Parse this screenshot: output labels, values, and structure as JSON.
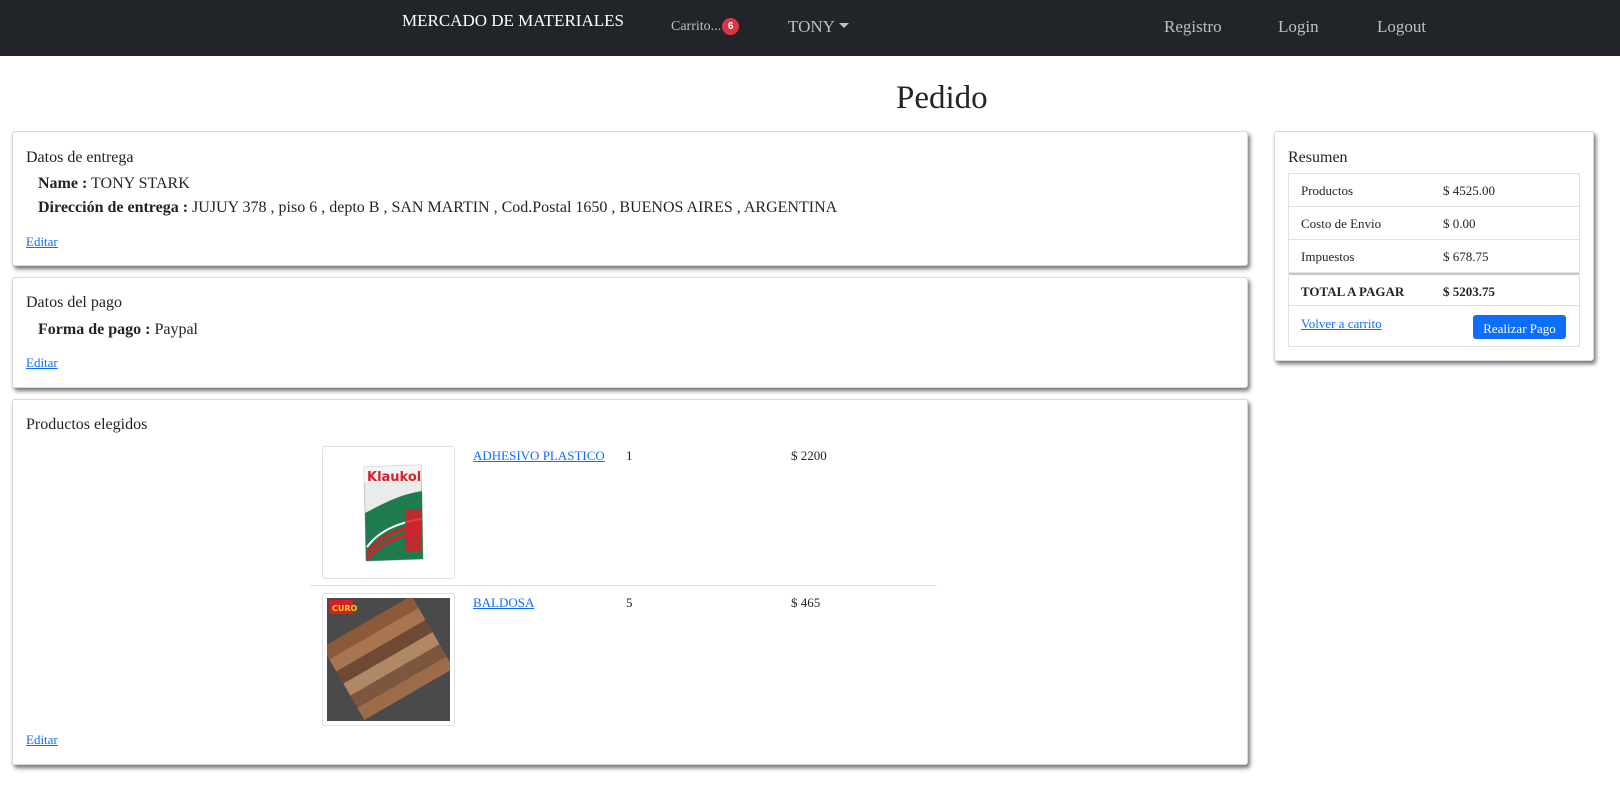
{
  "navbar": {
    "brand": "MERCADO DE MATERIALES",
    "cart_label": "Carrito...",
    "cart_count": "6",
    "user_label": "TONY",
    "links": {
      "registro": "Registro",
      "login": "Login",
      "logout": "Logout"
    }
  },
  "page": {
    "title": "Pedido"
  },
  "delivery": {
    "title": "Datos de entrega",
    "name_label": "Name :",
    "name_value": "TONY STARK",
    "address_label": "Dirección de entrega :",
    "address_value": "JUJUY 378 , piso 6 , depto B , SAN MARTIN , Cod.Postal 1650 , BUENOS AIRES , ARGENTINA",
    "edit_label": "Editar"
  },
  "payment": {
    "title": "Datos del pago",
    "method_label": "Forma de pago :",
    "method_value": "Paypal",
    "edit_label": "Editar"
  },
  "products": {
    "title": "Productos elegidos",
    "edit_label": "Editar",
    "items": [
      {
        "name": "ADHESIVO PLASTICO",
        "qty": "1",
        "price": "$ 2200",
        "image_brand": "Klaukol"
      },
      {
        "name": "BALDOSA",
        "qty": "5",
        "price": "$ 465",
        "image_brand": "CURO"
      }
    ]
  },
  "summary": {
    "title": "Resumen",
    "rows": [
      {
        "label": "Productos",
        "value": "$ 4525.00"
      },
      {
        "label": "Costo de Envio",
        "value": "$ 0.00"
      },
      {
        "label": "Impuestos",
        "value": "$ 678.75"
      }
    ],
    "total_label": "TOTAL A PAGAR",
    "total_value": "$ 5203.75",
    "back_label": "Volver a carrito",
    "pay_label": "Realizar Pago"
  },
  "colors": {
    "navbar": "#212529",
    "badge": "#dc3545",
    "link": "#0d6efd",
    "button": "#0d6efd"
  }
}
